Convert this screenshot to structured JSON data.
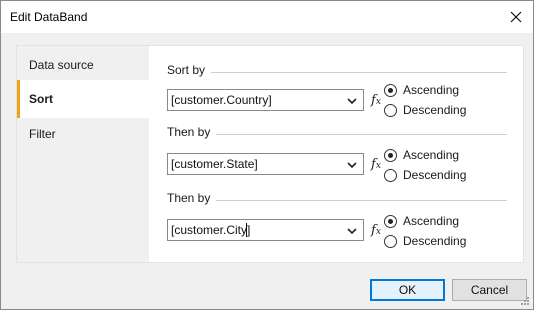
{
  "window": {
    "title": "Edit DataBand"
  },
  "nav": {
    "items": [
      {
        "label": "Data source",
        "selected": false
      },
      {
        "label": "Sort",
        "selected": true
      },
      {
        "label": "Filter",
        "selected": false
      }
    ]
  },
  "sort": {
    "groups": [
      {
        "label": "Sort by",
        "field": "[customer.Country]",
        "order": "Ascending"
      },
      {
        "label": "Then by",
        "field": "[customer.State]",
        "order": "Ascending"
      },
      {
        "label": "Then by",
        "field": "[customer.City]",
        "order": "Ascending"
      }
    ],
    "options": {
      "ascending": "Ascending",
      "descending": "Descending"
    },
    "fx_label": "f",
    "fx_sub": "x"
  },
  "buttons": {
    "ok": "OK",
    "cancel": "Cancel"
  },
  "icons": {
    "close": "close-icon",
    "dropdown": "chevron-down-icon",
    "fx": "function-icon",
    "grip": "resize-grip-icon"
  },
  "colors": {
    "accent": "#f0a21a",
    "default_button_border": "#0078d7"
  }
}
